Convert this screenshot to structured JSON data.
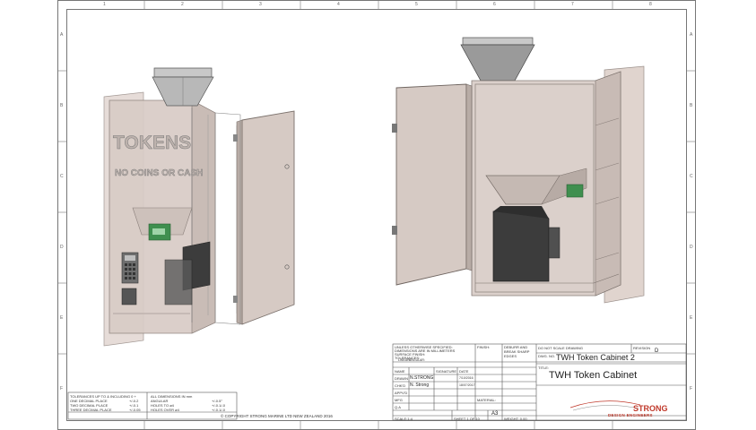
{
  "border_zones": {
    "columns": [
      "1",
      "2",
      "3",
      "4",
      "5",
      "6",
      "7",
      "8"
    ],
    "rows": [
      "A",
      "B",
      "C",
      "D",
      "E",
      "F"
    ]
  },
  "left_model": {
    "panel_text_1": "TOKENS",
    "panel_text_2": "NO COINS OR CASH"
  },
  "tolerance_block": {
    "line1": "TOLERANCES UP TO & INCLUDING 0 +",
    "line2": "ONE DECIMAL PLACE",
    "line2_value": "+/-0.2",
    "line3": "TWO DECIMAL PLACE",
    "line3_value": "+/-0.1",
    "line4": "THREE DECIMAL PLACE",
    "line4_value": "+/-0.05",
    "col2_line1": "ALL DIMENSIONS IN mm",
    "col2_line2": "ANGULAR",
    "col2_line2_value": "+/-0.5°",
    "col2_line3": "HOLES TO ø4",
    "col2_line3_value": "+/-0.1/-0",
    "col2_line4": "HOLES OVER ø4",
    "col2_line4_value": "+/-0.1/-0"
  },
  "copyright": "© COPYRIGHT STRONG MARINE LTD NEW ZEALAND 2016",
  "title_block": {
    "notes_line1": "UNLESS OTHERWISE SPECIFIED:",
    "notes_line2": "DIMENSIONS ARE IN MILLIMETERS",
    "notes_line3": "SURFACE FINISH:",
    "notes_line4": "TOLERANCES:",
    "notes_line5": "LINEAR:",
    "notes_line6": "ANGULAR:",
    "finish_label": "FINISH:",
    "deburr": "DEBURR AND BREAK SHARP EDGES",
    "do_not_scale": "DO NOT SCALE DRAWING",
    "revision_label": "REVISION",
    "revision_value": "D",
    "dwg_no_label": "DWG. NO.",
    "dwg_no": "TWH Token Cabinet 2",
    "title_label": "TITLE:",
    "title": "TWH Token Cabinet",
    "col_name": "NAME",
    "col_signature": "SIGNATURE",
    "col_date": "DATE",
    "drawn_label": "DRAWN",
    "drawn_name": "N.STRONG",
    "drawn_date": "7/10/2016",
    "chkd_label": "CHK'D",
    "chkd_name": "N. Strong",
    "chkd_date": "18/07/2017",
    "appvd_label": "APPV'D",
    "mfg_label": "MFG",
    "qa_label": "Q.A",
    "material_label": "MATERIAL:",
    "weight_label": "WEIGHT: 0.00",
    "scale_label": "SCALE:1:4",
    "sheet_label": "SHEET 1 OF 10",
    "size": "A3",
    "company": "STRONG",
    "company_sub": "DESIGN ENGINEERS"
  },
  "colors": {
    "accent": "#c0392b",
    "cabinet_fill": "#d4c8c2",
    "dark_part": "#3c3c3c",
    "green_part": "#3f8f4f"
  }
}
